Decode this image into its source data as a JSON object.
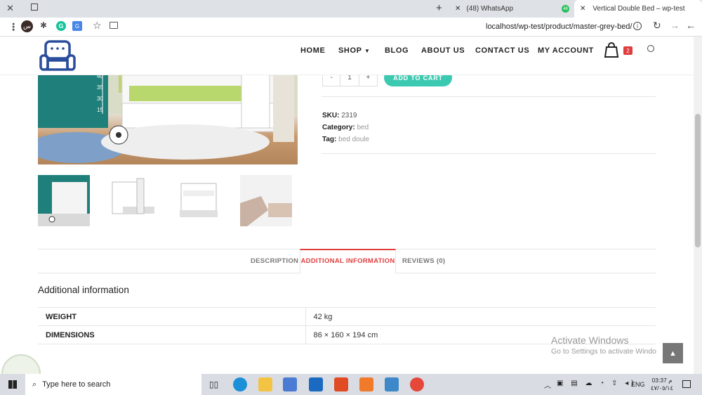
{
  "browser": {
    "tabs": [
      {
        "label": "(48) WhatsApp",
        "badge": "48"
      },
      {
        "label": "Vertical Double Bed – wp-test"
      }
    ],
    "url": "localhost/wp-test/product/master-grey-bed/",
    "profile_initial": "س"
  },
  "nav": {
    "items": [
      "HOME",
      "SHOP",
      "BLOG",
      "ABOUT US",
      "CONTACT US",
      "MY ACCOUNT"
    ],
    "cart_count": "2"
  },
  "product": {
    "quantity": "1",
    "minus": "-",
    "plus": "+",
    "add_to_cart": "ADD TO CART",
    "sku_label": "SKU:",
    "sku": "2319",
    "category_label": "Category:",
    "category": "bed",
    "tag_label": "Tag:",
    "tag": "bed doule",
    "ruler_marks": [
      "40",
      "35",
      "30",
      "15"
    ]
  },
  "tabs": {
    "items": [
      "DESCRIPTION",
      "ADDITIONAL INFORMATION",
      "REVIEWS (0)"
    ],
    "active": "ADDITIONAL INFORMATION"
  },
  "additional": {
    "heading": "Additional information",
    "rows": [
      {
        "key": "WEIGHT",
        "value": "42 kg"
      },
      {
        "key": "DIMENSIONS",
        "value": "86 × 160 × 194 cm"
      }
    ]
  },
  "watermark": {
    "title": "Activate Windows",
    "subtitle": "Go to Settings to activate Windo"
  },
  "taskbar": {
    "search_placeholder": "Type here to search",
    "time": "03:37 م",
    "date": "٤٧/٠٥/١٤",
    "lang": "ENG"
  },
  "colors": {
    "accent": "#e03e3e",
    "teal": "#3cc9b1",
    "logo_blue": "#2a4d9c"
  }
}
